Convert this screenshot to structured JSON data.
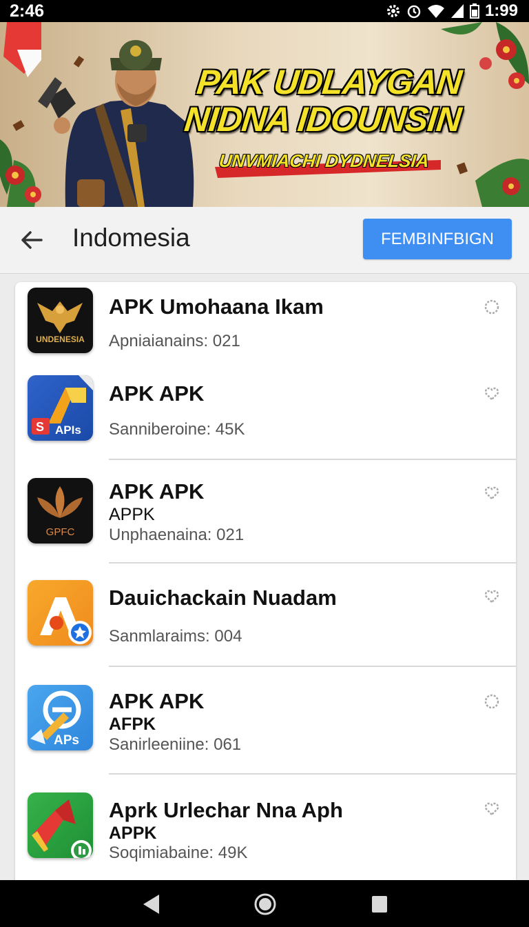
{
  "status_bar": {
    "time": "2:46",
    "battery_text": "1:99"
  },
  "banner": {
    "headline_1": "PAK UDLAYGAN",
    "headline_2": "NIDNA IDOUNSIN",
    "tagline": "UNVMIACHI DYDNELSIA"
  },
  "app_bar": {
    "title": "Indomesia",
    "action_label": "FEMBINFBIGN"
  },
  "apps": [
    {
      "name": "APK Umohaana Ikam",
      "sub": "",
      "meta": "Apniaianains: 021",
      "icon": "eagle-emblem-icon",
      "icon_text": "UNDENESIA"
    },
    {
      "name": "APK APK",
      "sub": "",
      "meta": "Sanniberoine: 45K",
      "icon": "apis-logo-icon",
      "icon_text": "APIs"
    },
    {
      "name": "APK APK",
      "sub": "APPK",
      "meta": "Unphaenaina: 021",
      "icon": "leaf-emblem-icon",
      "icon_text": "GPFC"
    },
    {
      "name": "Dauichackain Nuadam",
      "sub": "",
      "meta": "Sanmlaraims: 004",
      "icon": "orange-a-star-icon",
      "icon_text": ""
    },
    {
      "name": "APK APK",
      "sub": "AFPK",
      "meta": "Sanirleeniine: 061",
      "icon": "aps-blue-icon",
      "icon_text": "APs"
    },
    {
      "name": "Aprk Urlechar Nna Aph",
      "sub": "APPK",
      "meta": "Soqimiabaine: 49K",
      "icon": "green-arrow-icon",
      "icon_text": ""
    }
  ],
  "colors": {
    "accent": "#3f8ff3",
    "banner_text": "#f3e12a"
  }
}
